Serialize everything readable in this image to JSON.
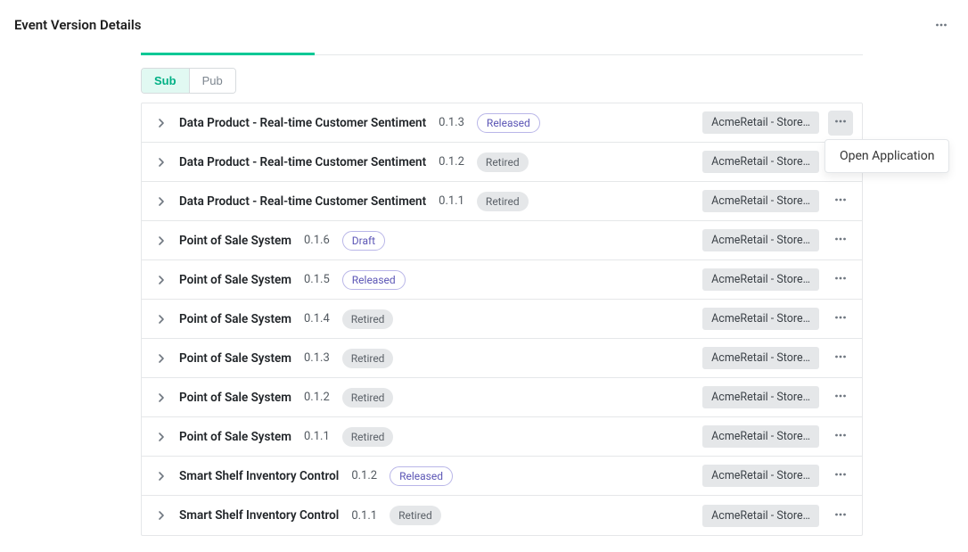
{
  "header": {
    "title": "Event Version Details"
  },
  "tabs": {
    "sub_label": "Sub",
    "pub_label": "Pub",
    "active": "sub"
  },
  "status_labels": {
    "released": "Released",
    "retired": "Retired",
    "draft": "Draft"
  },
  "rows": [
    {
      "name": "Data Product - Real-time Customer Sentiment",
      "version": "0.1.3",
      "status": "released",
      "tag": "AcmeRetail - Store…",
      "more_hover": true
    },
    {
      "name": "Data Product - Real-time Customer Sentiment",
      "version": "0.1.2",
      "status": "retired",
      "tag": "AcmeRetail - Store…"
    },
    {
      "name": "Data Product - Real-time Customer Sentiment",
      "version": "0.1.1",
      "status": "retired",
      "tag": "AcmeRetail - Store…"
    },
    {
      "name": "Point of Sale System",
      "version": "0.1.6",
      "status": "draft",
      "tag": "AcmeRetail - Store…"
    },
    {
      "name": "Point of Sale System",
      "version": "0.1.5",
      "status": "released",
      "tag": "AcmeRetail - Store…"
    },
    {
      "name": "Point of Sale System",
      "version": "0.1.4",
      "status": "retired",
      "tag": "AcmeRetail - Store…"
    },
    {
      "name": "Point of Sale System",
      "version": "0.1.3",
      "status": "retired",
      "tag": "AcmeRetail - Store…"
    },
    {
      "name": "Point of Sale System",
      "version": "0.1.2",
      "status": "retired",
      "tag": "AcmeRetail - Store…"
    },
    {
      "name": "Point of Sale System",
      "version": "0.1.1",
      "status": "retired",
      "tag": "AcmeRetail - Store…"
    },
    {
      "name": "Smart Shelf Inventory Control",
      "version": "0.1.2",
      "status": "released",
      "tag": "AcmeRetail - Store…"
    },
    {
      "name": "Smart Shelf Inventory Control",
      "version": "0.1.1",
      "status": "retired",
      "tag": "AcmeRetail - Store…"
    }
  ],
  "popover": {
    "open_application_label": "Open Application",
    "visible_on_row": 0
  }
}
